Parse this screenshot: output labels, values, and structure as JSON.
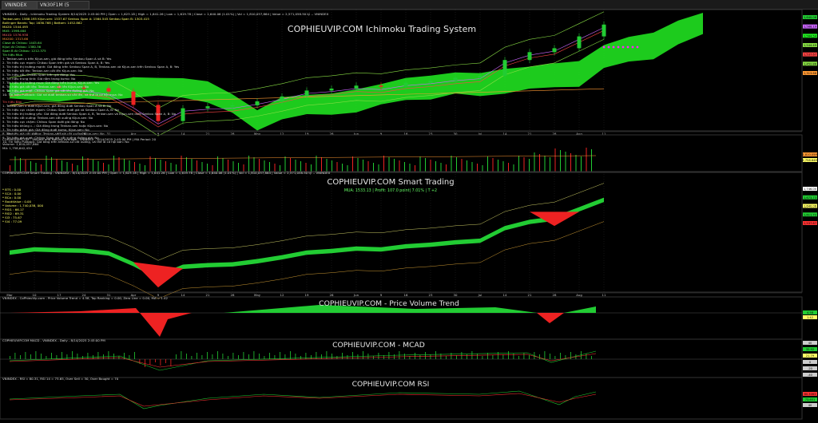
{
  "tabs": [
    "VNINDEX (Daily)",
    "VN30F1M (5 minutes)"
  ],
  "panels": {
    "ichimoku": {
      "title": "COPHIEUVIP.COM Ichimoku Trading System",
      "header": "VNINDEX - Daily - Ichimoku Trading System 8/14/2025 2:45:00 PM | Open = 1,623.18 | High = 1,641.26 | Low = 1,619.78 | Close = 1,640.06 (1.01%) | Vol = 1,810,057,864 | Value = 2,571,058.50 tỷ -- VNINDEX",
      "legend": [
        {
          "text": "Tenkan-sen: 1588.195   Kijun-sen: 1537.67   Senkou Span A: 1564.545   Senkou Span B: 1303.415",
          "color": "#ffff66"
        },
        {
          "text": "Bollinger Bands: Top: 1636.768 | Bottom: 1452.862",
          "color": "#ffff66"
        },
        {
          "text": "MA20: 1544.495",
          "color": "#ffff66"
        },
        {
          "text": "MA5: 1598.464",
          "color": "#66ff66"
        },
        {
          "text": "MA10: 1576.938",
          "color": "#ff6666"
        },
        {
          "text": "MA200: 1313.66",
          "color": "#ff9933"
        },
        {
          "text": "Close At Chikou: 1445.64",
          "color": "#66ff66"
        },
        {
          "text": "Kijun At Chikou: 1380.36",
          "color": "#66ff66"
        },
        {
          "text": "Span B At Chikou: 1212.375",
          "color": "#66ff66"
        }
      ],
      "signal_buy_title": "Tín hiệu Mua",
      "signals_buy": [
        "1. Tenkan-sen x trên Kijun-sen, giá đóng trên Senkou Span A và B: Yes",
        "2. Tín hiệu cực mạnh: Chikou Span trên giá và Senkou Span A, B: Yes",
        "3. Tín hiệu thị trường mạnh: Giá đóng trên Senkou Span A, B, Tenkan-sen và Kijun-sen trên Senkou Span A, B: Yes",
        "4. Tín hiệu tốt lên: Tenkan-sen cắt lên Kijun-sen: No",
        "5. Tín hiệu cắt: Chikou Span trên giá đóng: Yes",
        "6. Tín hiệu trung tính: Giá nằm trong kumo: No",
        "7. Tín hiệu thị trường mua: Giá đóng trên kumo, Kijun-sen: Yes",
        "8. Tín hiệu giá cắt lên: Tenkan-sen cắt lên Kijun-sen: No",
        "9. Tín hiệu giá vượt: Chikou Span giá cắt lên đường giá: No",
        "10. Tín hiệu Pullback: Giá rơi dưới tenkan-sư cắt lên, và thể là cơ hội mua: No"
      ],
      "signal_sell_title": "Tín hiệu Bán",
      "signals_sell": [
        "1. Tenkan-sen x dưới Kijun-sen, giá đóng dưới Senkou Span A và B: No",
        "2. Tín hiệu cực chậm mạnh: Chikou Span dưới giá và Senkou Span A, B: No",
        "3. Tín hiệu thị trường yếu: Giá đóng dưới Senkou Span A, B, Tenkan-sen và Kijun-sen dưới Senkou Span A, B: No",
        "4. Tín hiệu cắt xuống: Tenkan-sen cắt xuống Kijun-sen: No",
        "5. Tín hiệu cực chậm: Chikou Span dưới giá đóng: No",
        "6. Tín hiệu khủng c..: Giá đóng trong Tenkan-sen hoặc Kijun-sen: No",
        "7. Tín hiệu giảm giá: Giá đóng dưới kumo, Kijun-sen: No",
        "8. Tín hiệu giá cắt xuống: Tenkan-sen giá cắt xuống Kijun-sen: No",
        "9. Tín hiệu giá vượt: Chikou Span giá cắt xuống đường giá: No",
        "10. Tín hiệu Pullback: Giá tăng trên tenkan-sư cắt xuống, và thể là cơ hội bán: No"
      ],
      "price_labels": [
        "1,640.06",
        "1,588.19",
        "1,564.54",
        "1,544.49",
        "1,537.67",
        "1,452.86",
        "1,313.66"
      ]
    },
    "volume": {
      "header": "COPHIEUVIP.COM - Volume and Moving Average - VNINDEX - 8/14/2025 2:45:00 PM | MA Period: 20",
      "legend": [
        "Volume: 1,810,057,864",
        "MA: 1,758,642,434"
      ],
      "right_labels": [
        "1,810.05M",
        "1,758.64M"
      ]
    },
    "smart": {
      "title": "COPHIEUVIP.COM Smart Trading",
      "subtitle": "MUA: 1533.13 | Profit: 107.0 point| 7.01% | T +2",
      "header": "COPHIEUVIP.COM Smart Trading - VNINDEX - 8/14/2025 2:45:00 PM | Open = 1,623.18 | High = 1,641.26 | Low = 1,619.78 | Close = 1,640.06 (1.01%) | Vol = 1,810,057,864 | Value = 2,571,058.50 tỷ -- VNINDEX",
      "legend": [
        "* BTS : 0.00",
        "* SCA : 0.00",
        "* BCa : 0.00",
        "* BookValue : 0.00",
        "* Volume : 1,740,038, 000",
        "* RSI1 : 66.17",
        "* RSI2 : 69.31",
        "* SI3 : 75.67",
        "* SI4 : 77.09"
      ],
      "right_labels": [
        "1,746.00",
        "1,673.73",
        "1,640.06",
        "1,611.72",
        "1,537.67"
      ]
    },
    "pvt": {
      "title": "COPHIEUVIP.COM - Price Volume Trend",
      "header": "VNINDEX - CoPhieuVip.com - Price Volume Trend = 4.58, Top Ranking = 0.00, Zero Line = 0.00, MA = 1.42",
      "right_labels": [
        "4.58",
        "1.42"
      ]
    },
    "macd": {
      "title": "COPHIEUVIP.COM - MCAD",
      "header": "COPHIEUVIP.COM MACD - VNINDEX - Daily - 8/14/2025 2:45:00 PM",
      "right_labels": [
        "40",
        "32.92",
        "21.79",
        "0",
        "-20",
        "-40"
      ]
    },
    "rsi": {
      "title": "COPHIEUVIP.COM RSI",
      "header": "VNINDEX - RSI = 80.31, RSI 14 = 73.65, Over Sell = 30, Over Bought = 70",
      "right_labels": [
        "80.3063",
        "73.651",
        "40"
      ]
    }
  },
  "x_axis": [
    "Mar",
    "10",
    "17",
    "24",
    "31",
    "Apr",
    "9",
    "14",
    "21",
    "28",
    "May",
    "12",
    "19",
    "26",
    "Jun",
    "9",
    "16",
    "23",
    "30",
    "Jul",
    "14",
    "21",
    "28",
    "Aug",
    "11"
  ],
  "colors": {
    "bull": "#22cc33",
    "bear": "#ee2222",
    "cloud": "#22ee22",
    "grid": "#444444",
    "title": "#e6e6e6"
  },
  "chart_data": {
    "type": "line",
    "title": "COPHIEUVIP.COM Ichimoku Trading System",
    "x": [
      "Mar",
      "10",
      "17",
      "24",
      "31",
      "Apr",
      "9",
      "14",
      "21",
      "28",
      "May",
      "12",
      "19",
      "26",
      "Jun",
      "9",
      "16",
      "23",
      "30",
      "Jul",
      "14",
      "21",
      "28",
      "Aug",
      "11"
    ],
    "series": [
      {
        "name": "VNINDEX",
        "values": [
          1305,
          1325,
          1320,
          1317,
          1300,
          1232,
          1150,
          1215,
          1225,
          1230,
          1250,
          1275,
          1305,
          1315,
          1330,
          1325,
          1345,
          1355,
          1370,
          1380,
          1460,
          1500,
          1520,
          1580,
          1640.06
        ]
      }
    ],
    "ylim": [
      1100,
      1700
    ]
  }
}
